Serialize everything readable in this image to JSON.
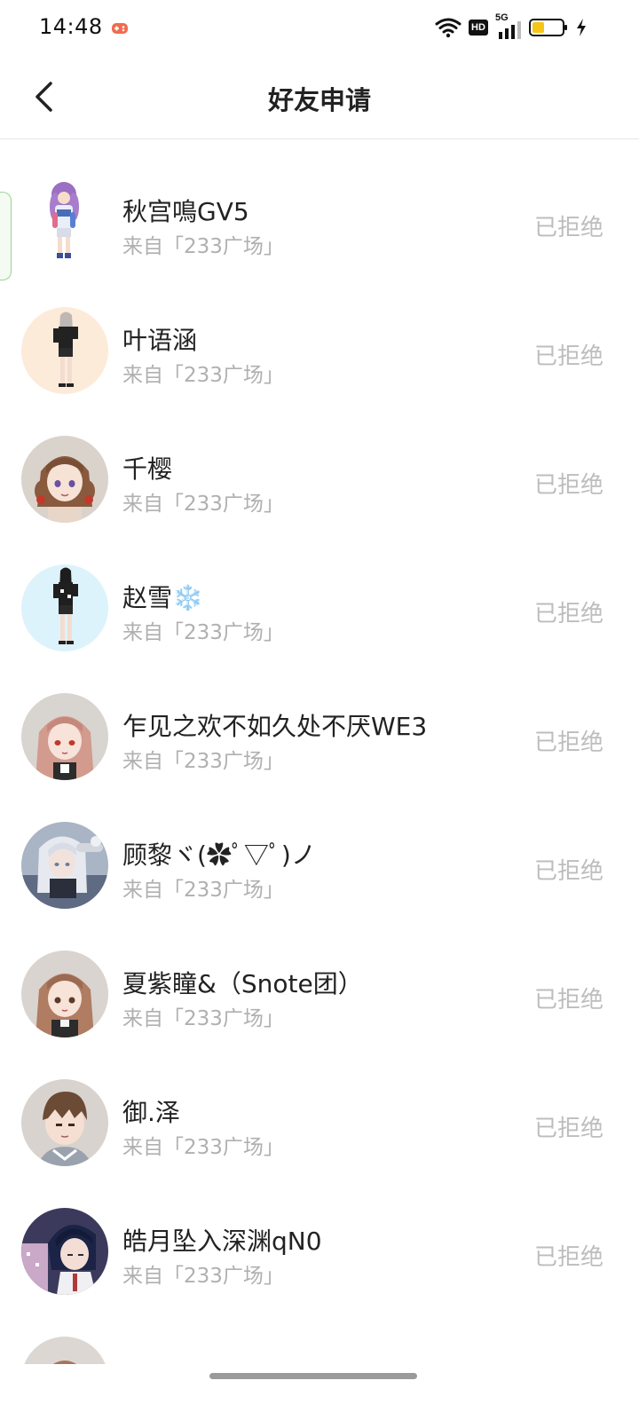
{
  "status_bar": {
    "time": "14:48",
    "hd_label": "HD",
    "network_label": "5G",
    "battery_color": "#f5c518"
  },
  "header": {
    "title": "好友申请"
  },
  "requests": [
    {
      "name": "秋宫鳴GV5",
      "source": "来自「233广场」",
      "status": "已拒绝"
    },
    {
      "name": "叶语涵",
      "source": "来自「233广场」",
      "status": "已拒绝"
    },
    {
      "name": "千樱",
      "source": "来自「233广场」",
      "status": "已拒绝"
    },
    {
      "name": "赵雪",
      "emoji": "❄️",
      "source": "来自「233广场」",
      "status": "已拒绝"
    },
    {
      "name": "乍见之欢不如久处不厌WE3",
      "source": "来自「233广场」",
      "status": "已拒绝"
    },
    {
      "name": "顾黎ヾ(✿ﾟ▽ﾟ)ノ",
      "source": "来自「233广场」",
      "status": "已拒绝"
    },
    {
      "name": "夏紫瞳&（Snote团）",
      "source": "来自「233广场」",
      "status": "已拒绝"
    },
    {
      "name": "御.泽",
      "source": "来自「233广场」",
      "status": "已拒绝"
    },
    {
      "name": "皓月坠入深渊qN0",
      "source": "来自「233广场」",
      "status": "已拒绝"
    },
    {
      "name": "",
      "source": "",
      "status": ""
    }
  ]
}
